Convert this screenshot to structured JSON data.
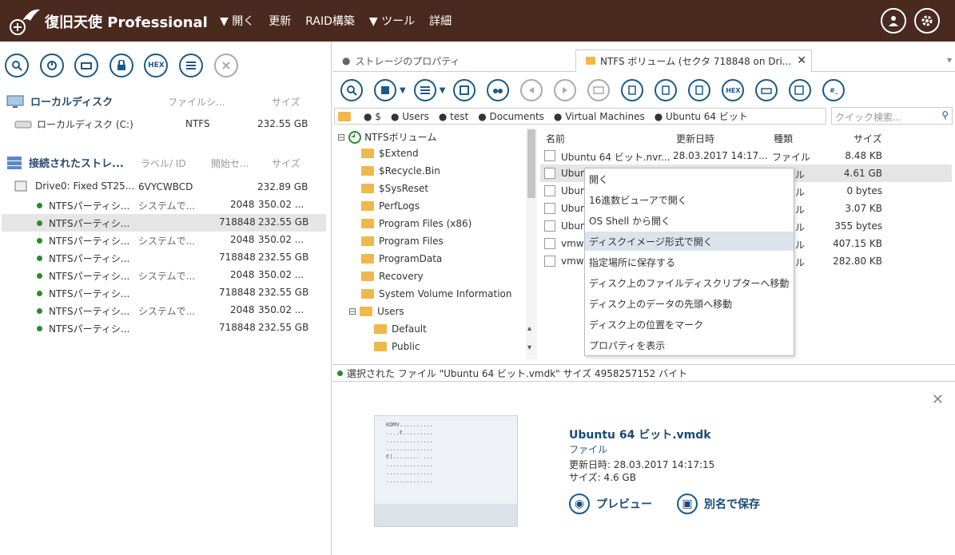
{
  "app": {
    "title": "復旧天使 Professional"
  },
  "menu": {
    "open": "開く",
    "refresh": "更新",
    "raid": "RAID構築",
    "tools": "ツール",
    "details": "詳細"
  },
  "left": {
    "toolbar": {
      "hex": "HEX"
    },
    "local_section": {
      "title": "ローカルディスク",
      "col_fs": "ファイルシ...",
      "col_size": "サイズ"
    },
    "local_disk": {
      "name": "ローカルディスク (C:)",
      "fs": "NTFS",
      "size": "232.55 GB"
    },
    "conn_section": {
      "title": "接続されたストレ...",
      "col_label": "ラベル/ ID",
      "col_start": "開始セ...",
      "col_size": "サイズ"
    },
    "drive": {
      "name": "Drive0: Fixed ST25...",
      "id": "6VYCWBCD",
      "size": "232.89 GB"
    },
    "partitions": [
      {
        "name": "NTFSパーティシ...",
        "label": "システムで...",
        "start": "2048",
        "size": "350.02 ..."
      },
      {
        "name": "NTFSパーティシ...",
        "label": "",
        "start": "718848",
        "size": "232.55 GB"
      },
      {
        "name": "NTFSパーティシ...",
        "label": "システムで...",
        "start": "2048",
        "size": "350.02 ..."
      },
      {
        "name": "NTFSパーティシ...",
        "label": "",
        "start": "718848",
        "size": "232.55 GB"
      },
      {
        "name": "NTFSパーティシ...",
        "label": "システムで...",
        "start": "2048",
        "size": "350.02 ..."
      },
      {
        "name": "NTFSパーティシ...",
        "label": "",
        "start": "718848",
        "size": "232.55 GB"
      },
      {
        "name": "NTFSパーティシ...",
        "label": "システムで...",
        "start": "2048",
        "size": "350.02 ..."
      },
      {
        "name": "NTFSパーティシ...",
        "label": "",
        "start": "718848",
        "size": "232.55 GB"
      }
    ]
  },
  "tabs": {
    "storage": "ストレージのプロパティ",
    "volume": "NTFS ボリューム (セクタ 718848 on Dri..."
  },
  "toolbar": {
    "hex": "HEX",
    "hash": "#_"
  },
  "breadcrumb": [
    "$",
    "Users",
    "test",
    "Documents",
    "Virtual Machines",
    "Ubuntu 64 ビット"
  ],
  "search": {
    "placeholder": "クイック検索..."
  },
  "tree": {
    "root": "NTFSボリューム",
    "items": [
      "$Extend",
      "$Recycle.Bin",
      "$SysReset",
      "PerfLogs",
      "Program Files (x86)",
      "Program Files",
      "ProgramData",
      "Recovery",
      "System Volume Information",
      "Users"
    ],
    "sub": [
      "Default",
      "Public"
    ]
  },
  "files": {
    "headers": {
      "name": "名前",
      "modified": "更新日時",
      "type": "種類",
      "size": "サイズ"
    },
    "rows": [
      {
        "name": "Ubuntu 64 ビット.nvr...",
        "modified": "28.03.2017 14:17...",
        "type": "ファイル",
        "size": "8.48 KB"
      },
      {
        "name": "Ubun",
        "modified": "",
        "type": "イル",
        "size": "4.61 GB"
      },
      {
        "name": "Ubun",
        "modified": "",
        "type": "イル",
        "size": "0 bytes"
      },
      {
        "name": "Ubun",
        "modified": "",
        "type": "イル",
        "size": "3.07 KB"
      },
      {
        "name": "Ubun",
        "modified": "",
        "type": "イル",
        "size": "355 bytes"
      },
      {
        "name": "vmw",
        "modified": "",
        "type": "イル",
        "size": "407.15 KB"
      },
      {
        "name": "vmw",
        "modified": "",
        "type": "イル",
        "size": "282.80 KB"
      }
    ]
  },
  "context_menu": [
    "開く",
    "16進数ビューアで開く",
    "OS Shell から開く",
    "ディスクイメージ形式で開く",
    "指定場所に保存する",
    "ディスク上のファイルディスクリプターへ移動",
    "ディスク上のデータの先頭へ移動",
    "ディスク上の位置をマーク",
    "プロパティを表示"
  ],
  "status": {
    "text": "選択された ファイル \"Ubuntu 64 ビット.vmdk\" サイズ 4958257152 バイト"
  },
  "preview": {
    "name": "Ubuntu 64 ビット.vmdk",
    "type": "ファイル",
    "modified": "更新日時: 28.03.2017 14:17:15",
    "size": "サイズ: 4.6 GB",
    "preview_btn": "プレビュー",
    "saveas_btn": "別名で保存",
    "thumb_lines": [
      "KDMV..........",
      "....€.........",
      "..............",
      "..............",
      "€(........ ...",
      "..............",
      "..............",
      ".............."
    ]
  }
}
